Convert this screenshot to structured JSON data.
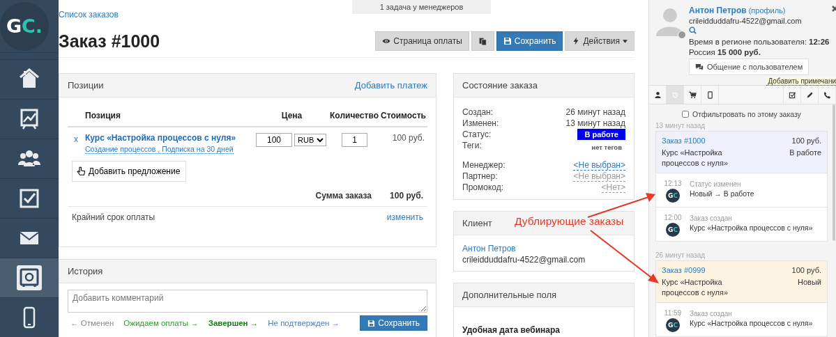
{
  "sidebar": {
    "logo": {
      "first": "G",
      "second": "C."
    },
    "items": [
      {
        "kind": "home",
        "selected": false
      },
      {
        "kind": "chart",
        "selected": false
      },
      {
        "kind": "people",
        "selected": false
      },
      {
        "kind": "task",
        "selected": false
      },
      {
        "kind": "mail",
        "selected": false
      },
      {
        "kind": "safe",
        "selected": true
      },
      {
        "kind": "phone",
        "selected": false
      }
    ]
  },
  "header": {
    "breadcrumb": "Список заказов",
    "tasks_banner": "1 задача у менеджеров",
    "title": "Заказ #1000",
    "buttons": [
      {
        "kind": "eye",
        "label": "Страница оплаты",
        "primary": false,
        "dropdown": false
      },
      {
        "kind": "copy",
        "primary": false,
        "dropdown": false
      },
      {
        "kind": "save",
        "label": "Сохранить",
        "primary": true,
        "dropdown": false
      },
      {
        "kind": "bolt",
        "label": "Действия",
        "primary": false,
        "dropdown": true
      }
    ]
  },
  "positions": {
    "title": "Позиции",
    "action": "Добавить платеж",
    "columns": [
      "Позиция",
      "Цена",
      "Количество",
      "Стоимость"
    ],
    "rows": [
      {
        "remove": "x",
        "name": "Курс «Настройка процессов с нуля»",
        "subtitle": "Создание процессов , Подписка на 30 дней",
        "price": "100",
        "currency": "RUB",
        "quantity": "1",
        "cost": "100 руб."
      }
    ],
    "add_offer": "Добавить предложение",
    "total_label": "Сумма заказа",
    "total_value": "100 руб.",
    "deadline_label": "Крайний срок оплаты",
    "deadline_action": "изменить"
  },
  "history": {
    "title": "История",
    "comment_placeholder": "Добавить комментарий",
    "status_links": [
      {
        "label": "← Отменен",
        "color": "#888888",
        "bold": false
      },
      {
        "label": "Ожидаем оплаты →",
        "color": "#2e9a2e",
        "bold": false
      },
      {
        "label": "Завершен →",
        "color": "#147a14",
        "bold": true
      },
      {
        "label": "Не подтвержден →",
        "color": "#4a80c4",
        "bold": false
      }
    ],
    "save_button": "Сохранить"
  },
  "order_state": {
    "title": "Состояние заказа",
    "groups": [
      [
        {
          "label": "Создан:",
          "value": "26 минут назад",
          "kind": "text"
        },
        {
          "label": "Изменен:",
          "value": "13 минут назад",
          "kind": "text"
        },
        {
          "label": "Статус:",
          "value": "В работе",
          "kind": "badge"
        },
        {
          "label": "Теги:",
          "value": "нет тегов",
          "kind": "tags"
        }
      ],
      [
        {
          "label": "Менеджер:",
          "value": "<Не выбран>",
          "kind": "link"
        },
        {
          "label": "Партнер:",
          "value": "<Не выбран>",
          "kind": "muted_link"
        },
        {
          "label": "Промокод:",
          "value": "<Нет>",
          "kind": "muted_link"
        }
      ]
    ]
  },
  "client": {
    "title": "Клиент",
    "name": "Антон Петров",
    "email": "crileidduddafru-4522@gmail.com"
  },
  "extra_fields": {
    "title": "Дополнительные поля",
    "field_label": "Удобная дата вебинара"
  },
  "annotation": {
    "text": "Дублирующие заказы"
  },
  "user_panel": {
    "name": "Антон Петров",
    "profile_link": "(профиль)",
    "email": "crileidduddafru-4522@gmail.com",
    "online": false,
    "time_label": "Время в регионе пользователя:",
    "time": "12:26",
    "country": "Россия",
    "amount": "15 000 руб.",
    "chat_button": "Общение с пользователем",
    "add_note": "Добавить примечани",
    "tabs": [
      {
        "kind": "person",
        "selected": false
      },
      {
        "kind": "history",
        "selected": true
      },
      {
        "kind": "cart",
        "selected": false
      },
      {
        "kind": "mobile",
        "selected": false
      },
      {
        "kind": "task",
        "selected": false
      },
      {
        "kind": "edit",
        "selected": false
      },
      {
        "kind": "call",
        "selected": false
      }
    ],
    "filter": {
      "label": "Отфильтровать по этому заказу",
      "checked": false
    },
    "feed": [
      {
        "time_ago": "13 минут назад",
        "order": {
          "title": "Заказ #1000",
          "amount": "100 руб.",
          "product": "Курс «Настройка процессов с нуля»",
          "status": "В работе",
          "color": "#eef0fb"
        },
        "events": [
          {
            "time": "12:13",
            "title": "Статус изменен",
            "text": "Новый → В работе",
            "logo": [
              "G",
              "C"
            ]
          },
          {
            "time": "12:00",
            "title": "Заказ создан",
            "text": "Курс «Настройка процессов с нуля»",
            "logo": [
              "G",
              "C"
            ]
          }
        ]
      },
      {
        "time_ago": "26 минут назад",
        "order": {
          "title": "Заказ #0999",
          "amount": "100 руб.",
          "product": "Курс «Настройка процессов с нуля»",
          "status": "Новый",
          "color": "#fdf3e1"
        },
        "events": [
          {
            "time": "11:59",
            "title": "Заказ создан",
            "text": "Курс «Настройка процессов с нуля»",
            "logo": [
              "G",
              "C"
            ]
          }
        ]
      }
    ]
  }
}
